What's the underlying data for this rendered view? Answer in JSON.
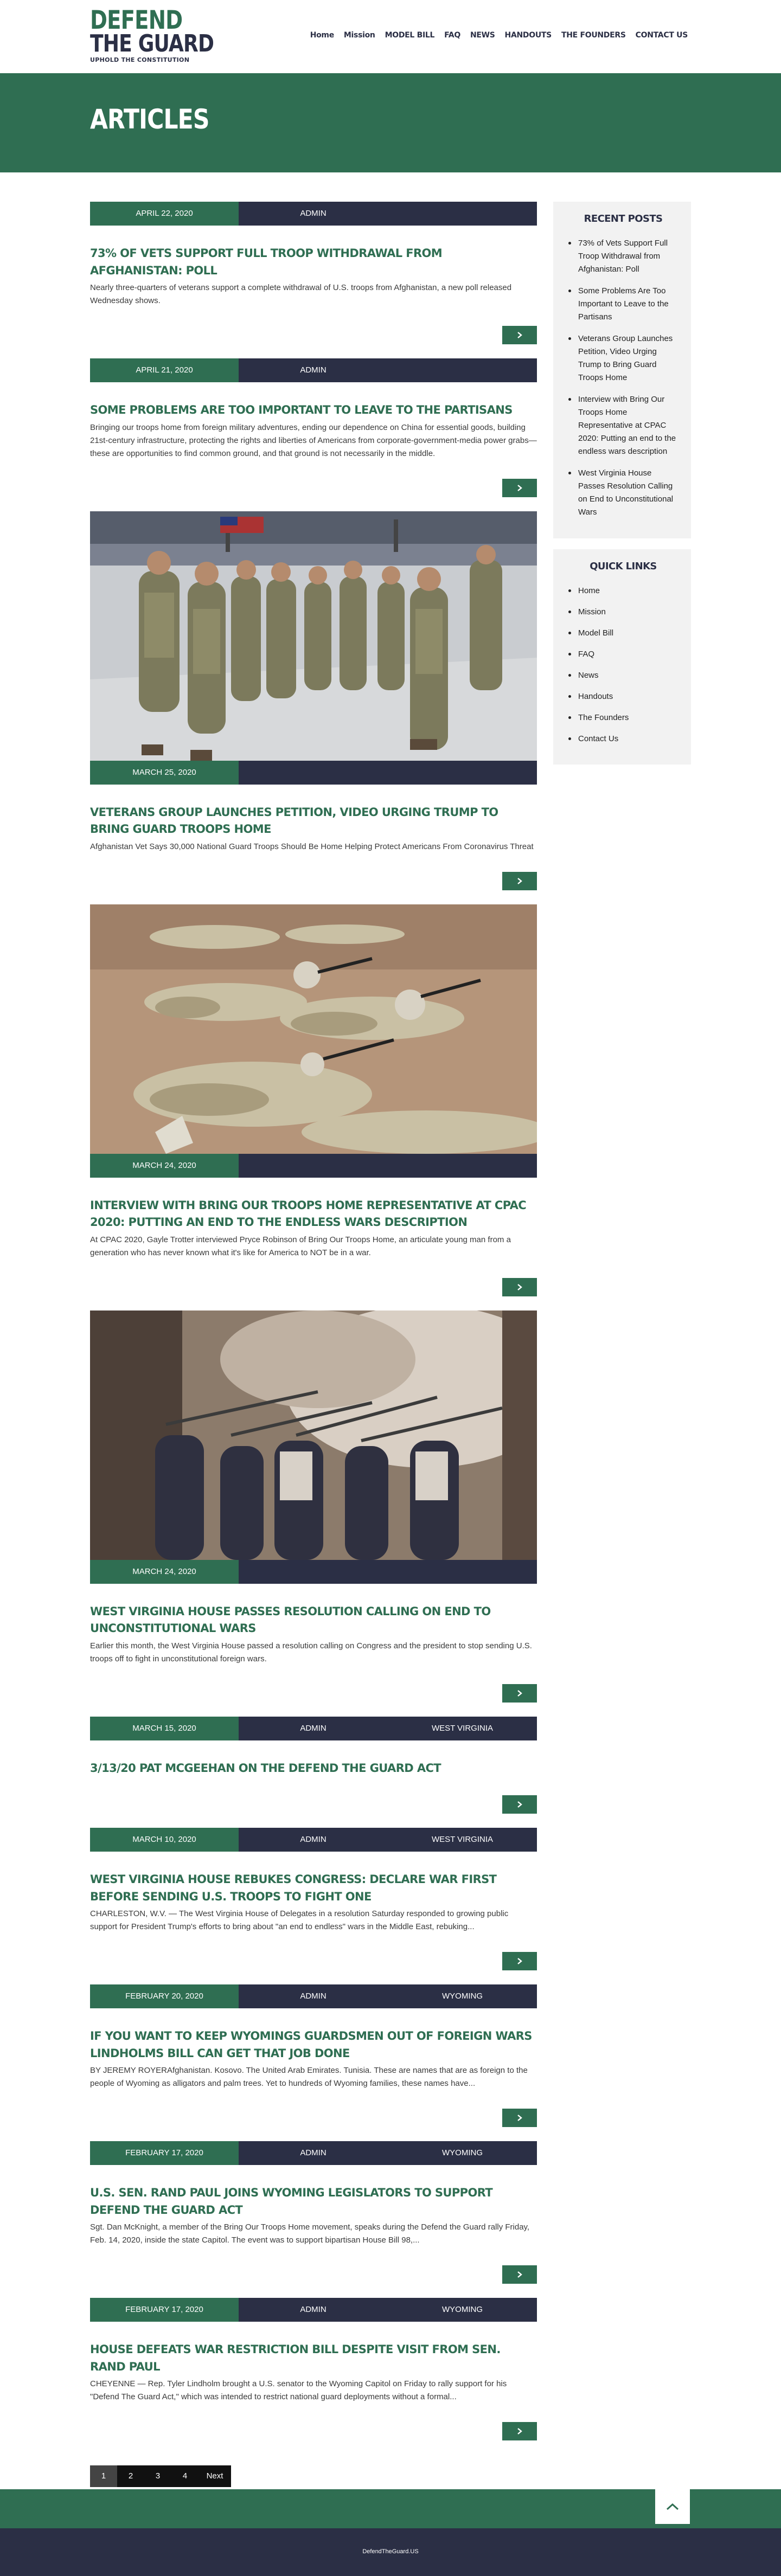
{
  "logo": {
    "line1": "DEFEND",
    "line2": "THE GUARD",
    "tagline": "UPHOLD THE CONSTITUTION"
  },
  "nav": [
    "Home",
    "Mission",
    "MODEL BILL",
    "FAQ",
    "NEWS",
    "HANDOUTS",
    "THE FOUNDERS",
    "CONTACT US"
  ],
  "hero": {
    "title": "ARTICLES"
  },
  "articles": [
    {
      "date": "APRIL 22, 2020",
      "author": "ADMIN",
      "category": "",
      "title": "73% of Vets Support Full Troop Withdrawal from Afghanistan: Poll",
      "excerpt": "Nearly three-quarters of veterans support a complete withdrawal of U.S. troops from Afghanistan, a new poll released Wednesday shows."
    },
    {
      "date": "APRIL 21, 2020",
      "author": "ADMIN",
      "category": "",
      "title": "Some Problems Are Too Important to Leave to the Partisans",
      "excerpt": "Bringing our troops home from foreign military adventures, ending our dependence on China for essential goods, building 21st-century infrastructure, protecting the rights and liberties of Americans from corporate-government-media power grabs—these are opportunities to find common ground, and that ground is not necessarily in the middle."
    },
    {
      "date": "MARCH 25, 2020",
      "author": "",
      "category": "",
      "title": "Veterans Group Launches Petition, Video Urging Trump to Bring Guard Troops Home",
      "excerpt": "Afghanistan Vet Says 30,000 National Guard Troops Should Be Home Helping Protect Americans From Coronavirus Threat"
    },
    {
      "date": "MARCH 24, 2020",
      "author": "",
      "category": "",
      "title": "Interview with Bring Our Troops Home Representative at CPAC 2020: Putting an end to the endless wars description",
      "excerpt": "At CPAC 2020, Gayle Trotter interviewed Pryce Robinson of Bring Our Troops Home, an articulate young man from a generation who has never known what it's like for America to NOT be in a war."
    },
    {
      "date": "MARCH 24, 2020",
      "author": "",
      "category": "",
      "title": "West Virginia House Passes Resolution Calling on End to Unconstitutional Wars",
      "excerpt": "Earlier this month, the West Virginia House passed a resolution calling on Congress and the president to stop sending U.S. troops off to fight in unconstitutional foreign wars."
    },
    {
      "date": "MARCH 15, 2020",
      "author": "ADMIN",
      "category": "WEST VIRGINIA",
      "title": "3/13/20 Pat McGeehan on the Defend the Guard Act",
      "excerpt": ""
    },
    {
      "date": "MARCH 10, 2020",
      "author": "ADMIN",
      "category": "WEST VIRGINIA",
      "title": "West Virginia House Rebukes Congress: Declare War First Before Sending U.S. Troops to Fight One",
      "excerpt": "CHARLESTON, W.V. — The West Virginia House of Delegates in a resolution Saturday responded to growing public support for President Trump's efforts to bring about \"an end to endless\" wars in the Middle East, rebuking..."
    },
    {
      "date": "FEBRUARY 20, 2020",
      "author": "ADMIN",
      "category": "WYOMING",
      "title": "If you want to keep Wyomings guardsmen out of foreign wars Lindholms bill can get that job done",
      "excerpt": "BY JEREMY ROYERAfghanistan. Kosovo. The United Arab Emirates. Tunisia. These are names that are as foreign to the people of Wyoming as alligators and palm trees. Yet to hundreds of Wyoming families, these names have..."
    },
    {
      "date": "FEBRUARY 17, 2020",
      "author": "ADMIN",
      "category": "WYOMING",
      "title": "U.S. Sen. Rand Paul joins Wyoming legislators to support Defend the Guard Act",
      "excerpt": "Sgt. Dan McKnight, a member of the Bring Our Troops Home movement, speaks during the Defend the Guard rally Friday, Feb. 14, 2020, inside the state Capitol. The event was to support bipartisan House Bill 98,..."
    },
    {
      "date": "FEBRUARY 17, 2020",
      "author": "ADMIN",
      "category": "WYOMING",
      "title": "House defeats war restriction bill despite visit from Sen. Rand Paul",
      "excerpt": "CHEYENNE — Rep. Tyler Lindholm brought a U.S. senator to the Wyoming Capitol on Friday to rally support for his \"Defend The Guard Act,\" which was intended to restrict national guard deployments without a formal..."
    }
  ],
  "pagination": {
    "pages": [
      "1",
      "2",
      "3",
      "4"
    ],
    "current": "1",
    "next": "Next"
  },
  "sidebar": {
    "recent_title": "RECENT POSTS",
    "recent": [
      "73% of Vets Support Full Troop Withdrawal from Afghanistan: Poll",
      "Some Problems Are Too Important to Leave to the Partisans",
      "Veterans Group Launches Petition, Video Urging Trump to Bring Guard Troops Home",
      "Interview with Bring Our Troops Home Representative at CPAC 2020: Putting an end to the endless wars description",
      "West Virginia House Passes Resolution Calling on End to Unconstitutional Wars"
    ],
    "quick_title": "QUICK LINKS",
    "quick": [
      "Home",
      "Mission",
      "Model Bill",
      "FAQ",
      "News",
      "Handouts",
      "The Founders",
      "Contact Us"
    ]
  },
  "footer": {
    "text": "DefendTheGuard.US"
  },
  "colors": {
    "green": "#2f6e52",
    "navy": "#2b2f45",
    "sidebar_bg": "#f2f2f2"
  },
  "icons": {
    "readmore": "chevron-right-icon",
    "back_to_top": "chevron-up-icon"
  }
}
